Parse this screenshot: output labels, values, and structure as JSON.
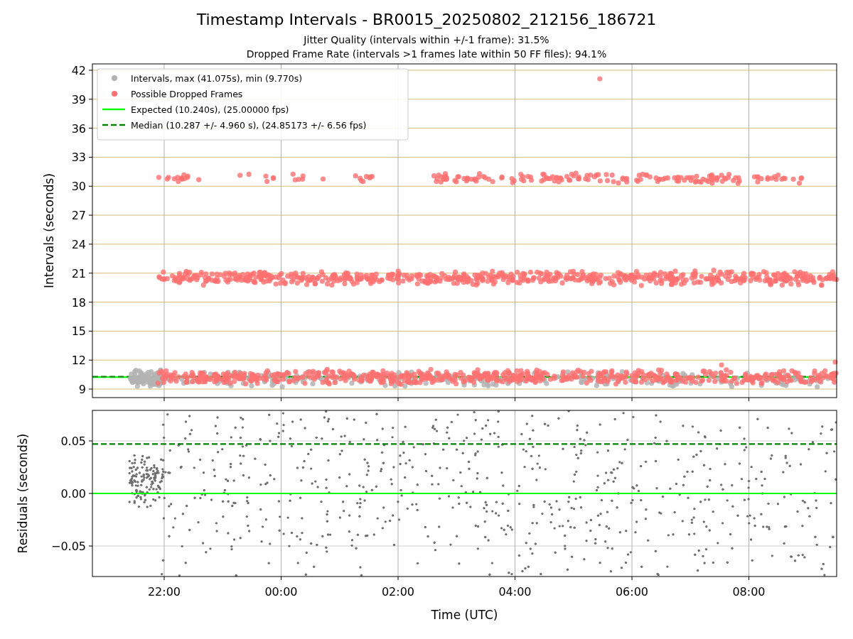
{
  "title": "Timestamp Intervals - BR0015_20250802_212156_186721",
  "subtitles": [
    "Jitter Quality (intervals within +/-1 frame): 31.5%",
    "Dropped Frame Rate (intervals >1 frames late within 50 FF files): 94.1%"
  ],
  "intervals_panel": {
    "y_axis_title": "Intervals (seconds)",
    "y_ticks": [
      "42",
      "39",
      "36",
      "33",
      "30",
      "27",
      "24",
      "21",
      "18",
      "15",
      "12",
      "9"
    ],
    "legend": [
      {
        "label": "Intervals, max (41.075s), min (9.770s)",
        "kind": "dot",
        "color": "#b3b3b3"
      },
      {
        "label": "Possible Dropped Frames",
        "kind": "dot",
        "color": "#ff7070"
      },
      {
        "label": "Expected (10.240s), (25.00000 fps)",
        "kind": "line",
        "color": "#00ff00"
      },
      {
        "label": "Median (10.287 +/- 4.960 s), (24.85173 +/- 6.56 fps)",
        "kind": "dashed_line",
        "color": "#008000"
      }
    ]
  },
  "residuals_panel": {
    "y_axis_title": "Residuals (seconds)",
    "y_ticks": [
      "0.05",
      "0.00",
      "−0.05"
    ],
    "x_ticks": [
      "22:00",
      "00:00",
      "02:00",
      "04:00",
      "06:00",
      "08:00"
    ],
    "x_axis_title": "Time (UTC)"
  }
}
